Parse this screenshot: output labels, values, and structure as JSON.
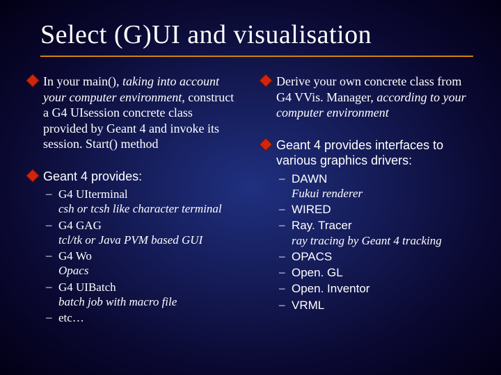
{
  "title": "Select (G)UI and visualisation",
  "col1": {
    "b1": {
      "t1": "In your main(), ",
      "t2": "taking into account your computer environment,",
      "t3": " construct a G4 UIsession concrete class provided by Geant 4 and invoke its session. Start() method"
    },
    "b2": {
      "head": "Geant 4 provides:",
      "items": [
        {
          "name": "G4 UIterminal",
          "desc": "csh or tcsh like character terminal"
        },
        {
          "name": "G4 GAG",
          "desc": "tcl/tk or Java PVM based GUI"
        },
        {
          "name": "G4 Wo",
          "desc": "Opacs"
        },
        {
          "name": "G4 UIBatch",
          "desc": "batch job with macro file"
        },
        {
          "name": "etc…",
          "desc": ""
        }
      ]
    }
  },
  "col2": {
    "b1": {
      "t1": "Derive your own concrete class from G4 VVis. Manager, ",
      "t2": "according to your computer environment"
    },
    "b2": {
      "head": "Geant 4 provides interfaces to various graphics drivers:",
      "items": [
        {
          "name": "DAWN",
          "desc": "Fukui renderer"
        },
        {
          "name": "WIRED",
          "desc": ""
        },
        {
          "name": "Ray. Tracer",
          "desc": "ray tracing by Geant 4 tracking"
        },
        {
          "name": "OPACS",
          "desc": ""
        },
        {
          "name": "Open. GL",
          "desc": ""
        },
        {
          "name": "Open. Inventor",
          "desc": ""
        },
        {
          "name": "VRML",
          "desc": ""
        }
      ]
    }
  }
}
